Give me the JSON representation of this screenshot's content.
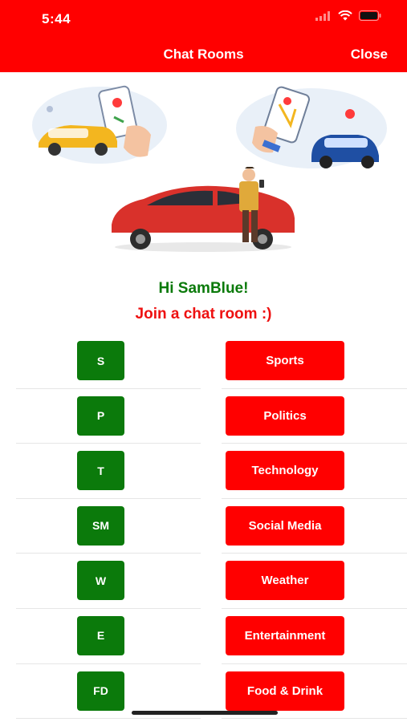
{
  "status_bar": {
    "time": "5:44"
  },
  "header": {
    "title": "Chat Rooms",
    "close_label": "Close"
  },
  "greeting": "Hi SamBlue!",
  "subtitle": "Join a chat room :)",
  "rooms": [
    {
      "abbr": "S",
      "name": "Sports"
    },
    {
      "abbr": "P",
      "name": "Politics"
    },
    {
      "abbr": "T",
      "name": "Technology"
    },
    {
      "abbr": "SM",
      "name": "Social Media"
    },
    {
      "abbr": "W",
      "name": "Weather"
    },
    {
      "abbr": "E",
      "name": "Entertainment"
    },
    {
      "abbr": "FD",
      "name": "Food & Drink"
    }
  ],
  "colors": {
    "header": "#ff0000",
    "abbr_button": "#0b7a0b",
    "room_button": "#ff0000",
    "greeting": "#0b7a0b",
    "subtitle": "#ee1111"
  },
  "icons": [
    "signal-icon",
    "wifi-icon",
    "battery-icon"
  ]
}
